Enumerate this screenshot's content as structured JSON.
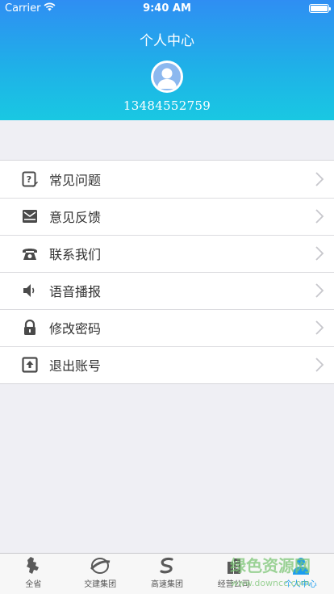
{
  "status_bar": {
    "carrier": "Carrier",
    "time": "9:40 AM"
  },
  "header": {
    "title": "个人中心",
    "phone": "13484552759"
  },
  "menu": [
    {
      "label": "常见问题",
      "icon": "help-doc-icon"
    },
    {
      "label": "意见反馈",
      "icon": "mail-icon"
    },
    {
      "label": "联系我们",
      "icon": "telephone-icon"
    },
    {
      "label": "语音播报",
      "icon": "speaker-icon"
    },
    {
      "label": "修改密码",
      "icon": "lock-icon"
    },
    {
      "label": "退出账号",
      "icon": "logout-icon"
    }
  ],
  "tabs": [
    {
      "label": "全省",
      "icon": "province-map-icon",
      "active": false
    },
    {
      "label": "交建集团",
      "icon": "jiaojian-logo-icon",
      "active": false
    },
    {
      "label": "高速集团",
      "icon": "gaosu-logo-icon",
      "active": false
    },
    {
      "label": "经营公司",
      "icon": "building-icon",
      "active": false
    },
    {
      "label": "个人中心",
      "icon": "person-icon",
      "active": true
    }
  ],
  "watermark": {
    "text": "绿色资源网",
    "url": "www.downcc.com"
  },
  "colors": {
    "accent": "#1a9cf0",
    "header_top": "#2f8ef3",
    "header_bottom": "#19c8e2",
    "icon": "#4a4a4a"
  }
}
